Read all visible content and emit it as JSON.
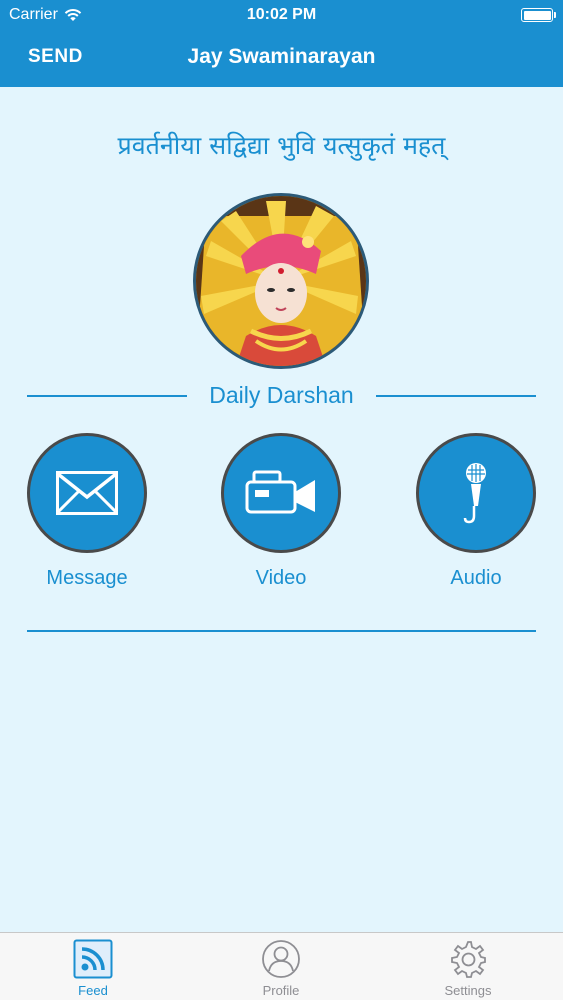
{
  "status_bar": {
    "carrier": "Carrier",
    "time": "10:02 PM"
  },
  "nav": {
    "send_label": "SEND",
    "title": "Jay Swaminarayan"
  },
  "sanskrit_line": "प्रवर्तनीया सद्विद्या भुवि यत्सुकृतं महत्",
  "darshan": {
    "label": "Daily Darshan"
  },
  "actions": [
    {
      "label": "Message",
      "icon": "envelope-icon"
    },
    {
      "label": "Video",
      "icon": "video-camera-icon"
    },
    {
      "label": "Audio",
      "icon": "microphone-icon"
    }
  ],
  "tabs": [
    {
      "label": "Feed",
      "icon": "rss-feed-icon",
      "active": true
    },
    {
      "label": "Profile",
      "icon": "profile-icon",
      "active": false
    },
    {
      "label": "Settings",
      "icon": "gear-icon",
      "active": false
    }
  ],
  "colors": {
    "accent": "#1a8fd0",
    "background": "#e3f5fd",
    "tab_inactive": "#8e8e93"
  }
}
